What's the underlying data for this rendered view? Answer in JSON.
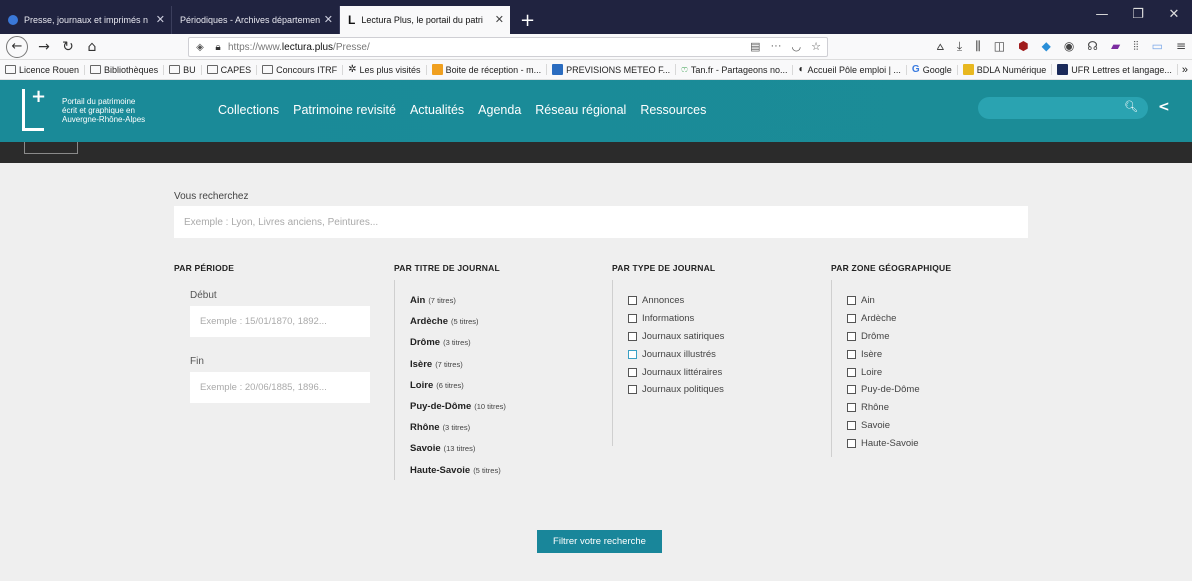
{
  "browser": {
    "tabs": [
      {
        "label": "Presse, journaux et imprimés n"
      },
      {
        "label": "Périodiques - Archives départemen"
      },
      {
        "label": "Lectura Plus, le portail du patri"
      }
    ],
    "url_prefix": "https://www.",
    "url_domain": "lectura.plus",
    "url_path": "/Presse/",
    "bookmarks": [
      {
        "label": "Licence Rouen",
        "icon": "folder-icon"
      },
      {
        "label": "Bibliothèques",
        "icon": "folder-icon"
      },
      {
        "label": "BU",
        "icon": "folder-icon"
      },
      {
        "label": "CAPES",
        "icon": "folder-icon"
      },
      {
        "label": "Concours ITRF",
        "icon": "folder-icon"
      },
      {
        "label": "Les plus visités",
        "icon": "gear-icon"
      },
      {
        "label": "Boite de réception - m...",
        "icon": "mail-icon"
      },
      {
        "label": "PREVISIONS METEO F...",
        "icon": "weather-icon"
      },
      {
        "label": "Tan.fr - Partageons no...",
        "icon": "tan-icon"
      },
      {
        "label": "Accueil Pôle emploi | ...",
        "icon": "pole-emploi-icon"
      },
      {
        "label": "Google",
        "icon": "google-icon"
      },
      {
        "label": "BDLA Numérique",
        "icon": "bdla-icon"
      },
      {
        "label": "UFR Lettres et langage...",
        "icon": "ufr-icon"
      }
    ]
  },
  "site": {
    "portal_line1": "Portail du patrimoine",
    "portal_line2": "écrit et graphique en",
    "portal_line3": "Auvergne-Rhône-Alpes",
    "nav": [
      "Collections",
      "Patrimoine revisité",
      "Actualités",
      "Agenda",
      "Réseau régional",
      "Ressources"
    ],
    "colors": {
      "accent": "#19869a",
      "header": "#1b8c97"
    }
  },
  "form": {
    "search_label": "Vous recherchez",
    "search_placeholder": "Exemple : Lyon, Livres anciens, Peintures...",
    "period": {
      "heading": "PAR PÉRIODE",
      "start_label": "Début",
      "start_placeholder": "Exemple : 15/01/1870, 1892...",
      "end_label": "Fin",
      "end_placeholder": "Exemple : 20/06/1885, 1896..."
    },
    "titles": {
      "heading": "PAR TITRE DE JOURNAL",
      "items": [
        {
          "name": "Ain",
          "count": "(7 titres)"
        },
        {
          "name": "Ardèche",
          "count": "(5 titres)"
        },
        {
          "name": "Drôme",
          "count": "(3 titres)"
        },
        {
          "name": "Isère",
          "count": "(7 titres)"
        },
        {
          "name": "Loire",
          "count": "(6 titres)"
        },
        {
          "name": "Puy-de-Dôme",
          "count": "(10 titres)"
        },
        {
          "name": "Rhône",
          "count": "(3 titres)"
        },
        {
          "name": "Savoie",
          "count": "(13 titres)"
        },
        {
          "name": "Haute-Savoie",
          "count": "(5 titres)"
        }
      ]
    },
    "types": {
      "heading": "PAR TYPE DE JOURNAL",
      "items": [
        "Annonces",
        "Informations",
        "Journaux satiriques",
        "Journaux illustrés",
        "Journaux littéraires",
        "Journaux politiques"
      ]
    },
    "zones": {
      "heading": "PAR ZONE GÉOGRAPHIQUE",
      "items": [
        "Ain",
        "Ardèche",
        "Drôme",
        "Isère",
        "Loire",
        "Puy-de-Dôme",
        "Rhône",
        "Savoie",
        "Haute-Savoie"
      ]
    },
    "submit_label": "Filtrer votre recherche"
  }
}
